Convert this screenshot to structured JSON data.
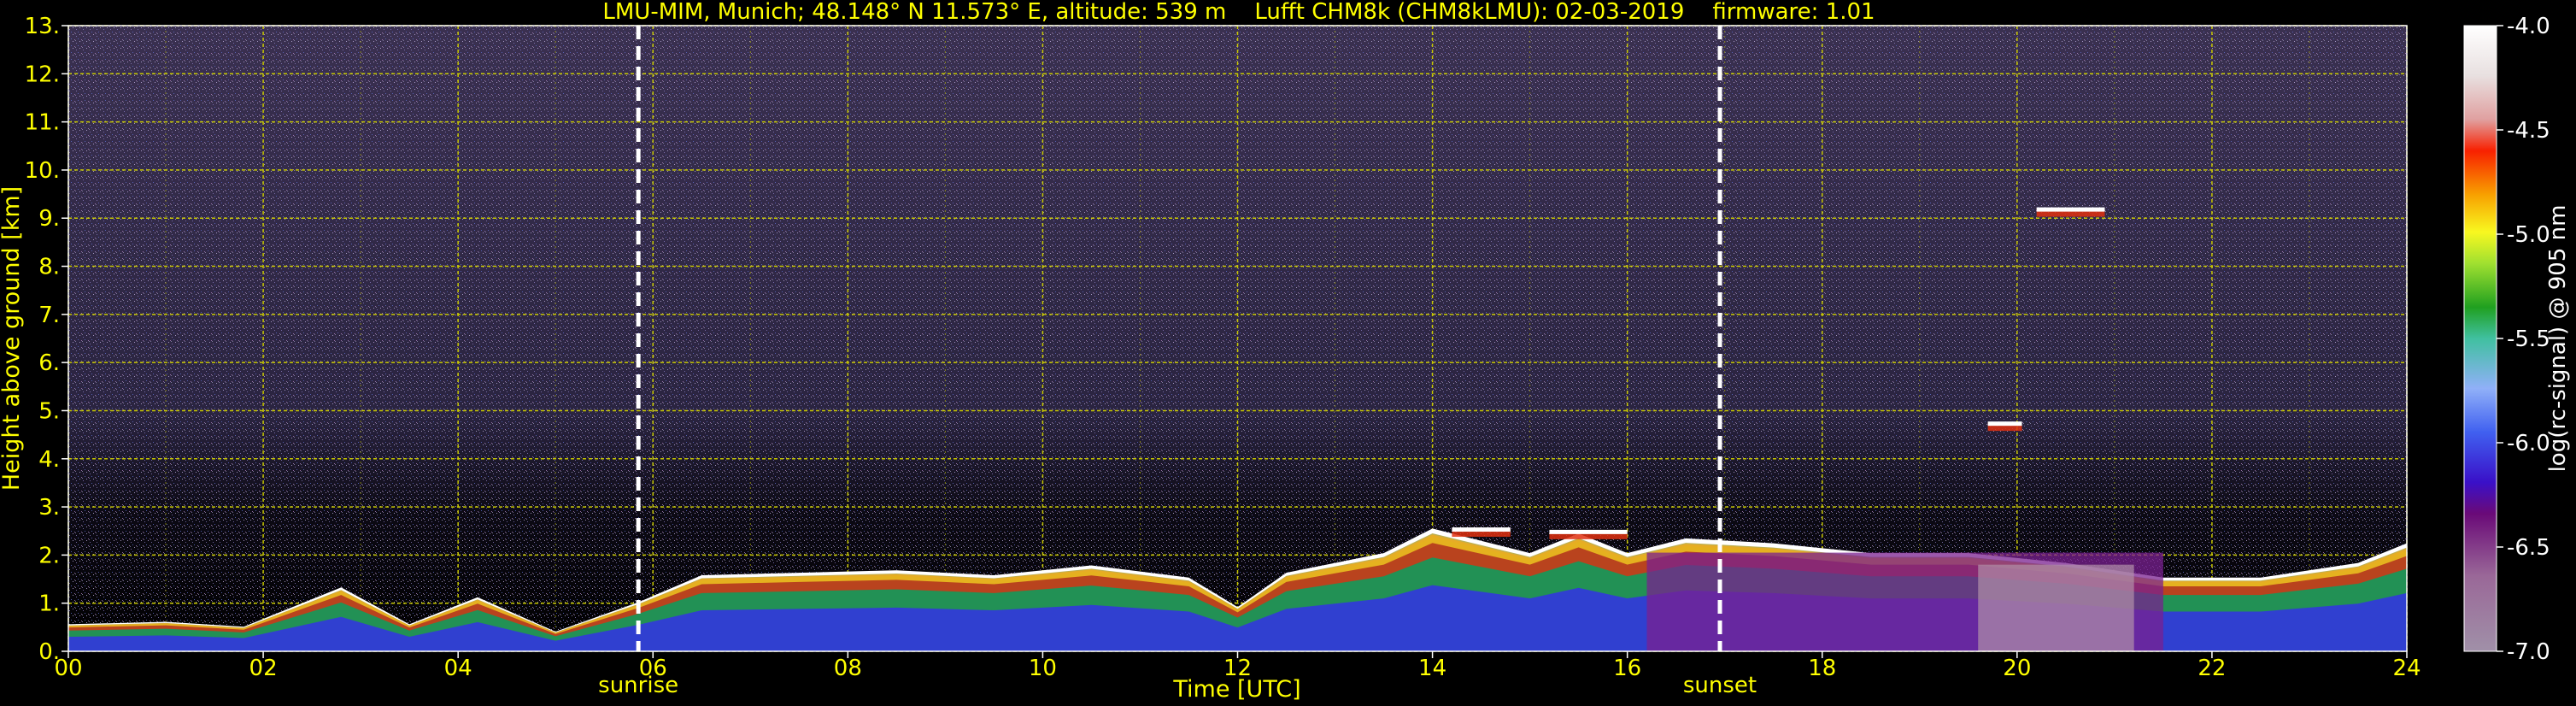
{
  "chart_data": {
    "type": "heatmap",
    "title": "LMU-MIM, Munich; 48.148° N 11.573° E, altitude: 539 m    Lufft CHM8k (CHM8kLMU): 02-03-2019    firmware: 1.01",
    "xlabel": "Time [UTC]",
    "ylabel": "Height above ground [km]",
    "colorbar_label": "log(rc-signal) @ 905 nm",
    "xlim": [
      0,
      24
    ],
    "ylim": [
      0,
      13
    ],
    "x_ticks": [
      "00",
      "02",
      "04",
      "06",
      "08",
      "10",
      "12",
      "14",
      "16",
      "18",
      "20",
      "22",
      "24"
    ],
    "y_ticks": [
      "0.",
      "1.",
      "2.",
      "3.",
      "4.",
      "5.",
      "6.",
      "7.",
      "8.",
      "9.",
      "10.",
      "11.",
      "12.",
      "13."
    ],
    "colorbar_ticks": [
      "-4.0",
      "-4.5",
      "-5.0",
      "-5.5",
      "-6.0",
      "-6.5",
      "-7.0"
    ],
    "colorbar_range": [
      -7.0,
      -4.0
    ],
    "grid": true,
    "events": [
      {
        "label": "sunrise",
        "x": 5.85
      },
      {
        "label": "sunset",
        "x": 16.95
      }
    ],
    "cloud_base_height_km": [
      [
        0,
        0.55
      ],
      [
        1,
        0.6
      ],
      [
        1.8,
        0.5
      ],
      [
        2.8,
        1.3
      ],
      [
        3.5,
        0.55
      ],
      [
        4.2,
        1.1
      ],
      [
        5.0,
        0.4
      ],
      [
        5.85,
        1.0
      ],
      [
        6.5,
        1.55
      ],
      [
        7.5,
        1.6
      ],
      [
        8.5,
        1.65
      ],
      [
        9.5,
        1.55
      ],
      [
        10.5,
        1.75
      ],
      [
        11.5,
        1.5
      ],
      [
        12.0,
        0.9
      ],
      [
        12.5,
        1.6
      ],
      [
        13.5,
        2.0
      ],
      [
        14.0,
        2.5
      ],
      [
        15.0,
        2.0
      ],
      [
        15.5,
        2.4
      ],
      [
        16.0,
        2.0
      ],
      [
        16.6,
        2.3
      ],
      [
        17.5,
        2.2
      ],
      [
        18.5,
        2.0
      ],
      [
        19.5,
        2.0
      ],
      [
        20.5,
        1.8
      ],
      [
        21.5,
        1.5
      ],
      [
        22.5,
        1.5
      ],
      [
        23.5,
        1.8
      ],
      [
        24,
        2.2
      ]
    ],
    "elevated_layers": [
      {
        "x_start": 14.2,
        "x_end": 14.8,
        "height_km": 2.45
      },
      {
        "x_start": 15.2,
        "x_end": 16.0,
        "height_km": 2.4
      },
      {
        "x_start": 19.7,
        "x_end": 20.05,
        "height_km": 4.65
      },
      {
        "x_start": 20.2,
        "x_end": 20.9,
        "height_km": 9.1
      }
    ],
    "colors": {
      "axis_text": "#ffff00",
      "grid": "#c8c800",
      "event_line": "#ffffff",
      "background": "#000000"
    }
  }
}
